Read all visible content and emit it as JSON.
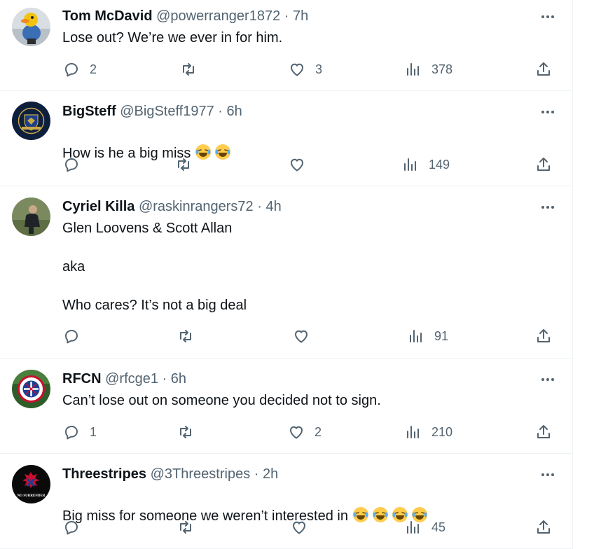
{
  "tweets": [
    {
      "name": "Tom McDavid",
      "handle": "@powerranger1872",
      "sep": "·",
      "time": "7h",
      "text": "Lose out? We’re we ever in for him.",
      "emojis": [],
      "replies": "2",
      "retweets": "",
      "likes": "3",
      "views": "378",
      "avatar": "duck"
    },
    {
      "name": "BigSteff",
      "handle": "@BigSteff1977",
      "sep": "·",
      "time": "6h",
      "text": "How is he a big miss ",
      "emojis": [
        "joy-emoji",
        "joy-emoji"
      ],
      "replies": "",
      "retweets": "",
      "likes": "",
      "views": "149",
      "avatar": "crest-navy"
    },
    {
      "name": "Cyriel Killa",
      "handle": "@raskinrangers72",
      "sep": "·",
      "time": "4h",
      "text": "Glen Loovens & Scott Allan\n\naka\n\nWho cares? It’s not a big deal",
      "emojis": [],
      "replies": "",
      "retweets": "",
      "likes": "",
      "views": "91",
      "avatar": "photo-man"
    },
    {
      "name": "RFCN",
      "handle": "@rfcge1",
      "sep": "·",
      "time": "6h",
      "text": "Can’t lose out on someone you decided not to sign.",
      "emojis": [],
      "replies": "1",
      "retweets": "",
      "likes": "2",
      "views": "210",
      "avatar": "rangers-badge"
    },
    {
      "name": "Threestripes",
      "handle": "@3Threestripes",
      "sep": "·",
      "time": "2h",
      "text": "Big miss for someone we weren’t interested in ",
      "emojis": [
        "joy-emoji",
        "joy-emoji",
        "joy-emoji",
        "joy-emoji"
      ],
      "replies": "",
      "retweets": "",
      "likes": "",
      "views": "45",
      "avatar": "lion-dark",
      "avatar_text": "NO SURRENDER"
    }
  ],
  "colors": {
    "text": "#0f1419",
    "secondary": "#536471",
    "border": "#eff3f4",
    "emoji": "#ffcc4d"
  }
}
